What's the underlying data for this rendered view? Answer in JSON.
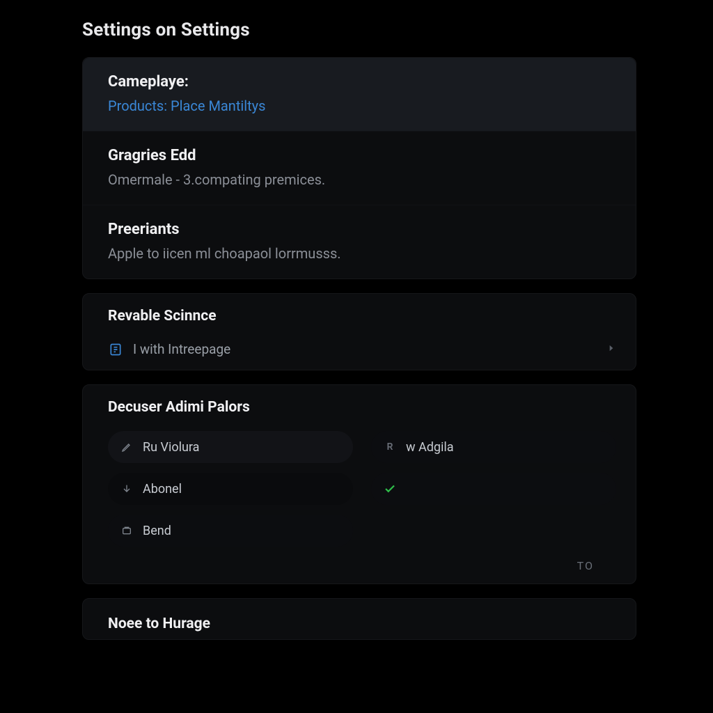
{
  "title": "Settings on Settings",
  "group1": {
    "items": [
      {
        "title": "Cameplaye:",
        "subtitle": "Products: Place Mantiltys",
        "link": true,
        "selected": true
      },
      {
        "title": "Gragries Edd",
        "subtitle": "Omermale - 3.compating premices.",
        "link": false,
        "selected": false
      },
      {
        "title": "Preeriants",
        "subtitle": "Apple to iicen ml choapaol lorrmusss.",
        "link": false,
        "selected": false
      }
    ]
  },
  "group2": {
    "header": "Revable Scinnce",
    "nav": {
      "label": "I with Intreepage"
    }
  },
  "group3": {
    "header": "Decuser Adimi Palors",
    "pills": [
      {
        "icon": "pen",
        "label": "Ru Violura"
      },
      {
        "icon": "letter-r",
        "label": "w Adgila"
      },
      {
        "icon": "arrow-down",
        "label": "Abonel"
      },
      {
        "icon": "check",
        "label": ""
      },
      {
        "icon": "package",
        "label": "Bend"
      }
    ],
    "to_label": "TO"
  },
  "group4": {
    "header": "Noee to Hurage"
  }
}
